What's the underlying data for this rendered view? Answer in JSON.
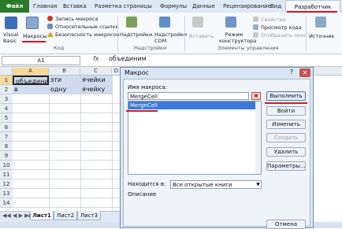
{
  "ribbon": {
    "tabs": [
      "Файл",
      "Главная",
      "Вставка",
      "Разметка страницы",
      "Формулы",
      "Данные",
      "Рецензирование",
      "Вид",
      "Разработчик"
    ],
    "code_group": {
      "visual_basic": "Visual Basic",
      "macros": "Макросы",
      "record_macro": "Запись макроса",
      "relative_refs": "Относительные ссылки",
      "macro_security": "Безопасность макросов",
      "group_label": "Код"
    },
    "addins_group": {
      "addins": "Надстройки",
      "com_addins": "Надстройки COM",
      "group_label": "Надстройки"
    },
    "controls_group": {
      "insert": "Вставить",
      "design_mode": "Режим конструктора",
      "properties": "Свойства",
      "view_code": "Просмотр кода",
      "run_dialog": "Отобразить окно",
      "group_label": "Элементы управления"
    },
    "xml_group": {
      "source": "Источник"
    }
  },
  "formula_bar": {
    "name_box": "A1",
    "fx": "fx",
    "content": "объединим"
  },
  "grid": {
    "columns": [
      "A",
      "B",
      "C",
      "D"
    ],
    "rows": [
      "1",
      "2",
      "3",
      "4",
      "5",
      "6",
      "7",
      "8",
      "9",
      "10",
      "11",
      "12",
      "13",
      "14"
    ],
    "cells": [
      [
        "объединим",
        "эти",
        "ячейки"
      ],
      [
        "в",
        "одну",
        "ячейку"
      ]
    ]
  },
  "sheets": [
    "Лист1",
    "Лист2",
    "Лист3"
  ],
  "dialog": {
    "title": "Макрос",
    "close": "✕",
    "name_label": "Имя макроса:",
    "macro_name": "MergeCell",
    "macro_list": [
      "MergeCell"
    ],
    "buttons": [
      "Выполнить",
      "Войти",
      "Изменить",
      "Создать",
      "Удалить",
      "Параметры..."
    ],
    "location_label": "Находится в:",
    "location_value": "Все открытые книги",
    "description_label": "Описание",
    "cancel": "Отмена"
  },
  "colors": {
    "highlight": "#e0101e",
    "accent": "#3b78d8",
    "file_tab": "#2a7a2a"
  }
}
